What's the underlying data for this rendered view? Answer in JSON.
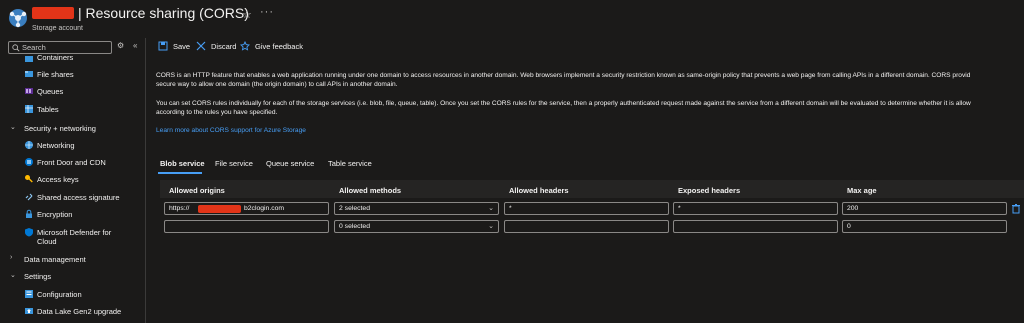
{
  "header": {
    "title": "| Resource sharing (CORS)",
    "subtitle": "Storage account",
    "star": "☆",
    "more": "···"
  },
  "sidebar": {
    "search_placeholder": "Search",
    "settings_ctl": "⚙",
    "collapse_ctl": "«",
    "items": [
      {
        "label": "Containers",
        "icon": "containers-icon"
      },
      {
        "label": "File shares",
        "icon": "file-shares-icon"
      },
      {
        "label": "Queues",
        "icon": "queues-icon"
      },
      {
        "label": "Tables",
        "icon": "tables-icon"
      }
    ],
    "security_group": "Security + networking",
    "security_items": [
      {
        "label": "Networking",
        "icon": "networking-icon"
      },
      {
        "label": "Front Door and CDN",
        "icon": "front-door-icon"
      },
      {
        "label": "Access keys",
        "icon": "key-icon"
      },
      {
        "label": "Shared access signature",
        "icon": "link-icon"
      },
      {
        "label": "Encryption",
        "icon": "lock-icon"
      },
      {
        "label": "Microsoft Defender for",
        "label2": "Cloud",
        "icon": "shield-icon"
      }
    ],
    "data_management_group": "Data management",
    "settings_group": "Settings",
    "settings_items": [
      {
        "label": "Configuration",
        "icon": "configuration-icon"
      },
      {
        "label": "Data Lake Gen2 upgrade",
        "icon": "upgrade-icon"
      }
    ]
  },
  "toolbar": {
    "save": "Save",
    "discard": "Discard",
    "feedback": "Give feedback"
  },
  "description": {
    "line1": "CORS is an HTTP feature that enables a web application running under one domain to access resources in another domain. Web browsers implement a security restriction known as same-origin policy that prevents a web page from calling APIs in a different domain. CORS provid",
    "line2": "secure way to allow one domain (the origin domain) to call APIs in another domain.",
    "line3": "You can set CORS rules individually for each of the storage services (i.e. blob, file, queue, table). Once you set the CORS rules for the service, then a properly authenticated request made against the service from a different domain will be evaluated to determine whether it is allow",
    "line4": "according to the rules you have specified.",
    "learn_more": "Learn more about CORS support for Azure Storage"
  },
  "tabs": [
    "Blob service",
    "File service",
    "Queue service",
    "Table service"
  ],
  "table": {
    "headers": [
      "Allowed origins",
      "Allowed methods",
      "Allowed headers",
      "Exposed headers",
      "Max age"
    ],
    "rows": [
      {
        "origin_prefix": "https://",
        "origin_suffix": "b2clogin.com",
        "methods": "2 selected",
        "allowed_headers": "*",
        "exposed_headers": "*",
        "max_age": "200"
      },
      {
        "origin_prefix": "",
        "origin_suffix": "",
        "methods": "0 selected",
        "allowed_headers": "",
        "exposed_headers": "",
        "max_age": "0"
      }
    ]
  },
  "colors": {
    "accent": "#479ef5",
    "background": "#1b1a19",
    "redaction": "#e23418"
  }
}
